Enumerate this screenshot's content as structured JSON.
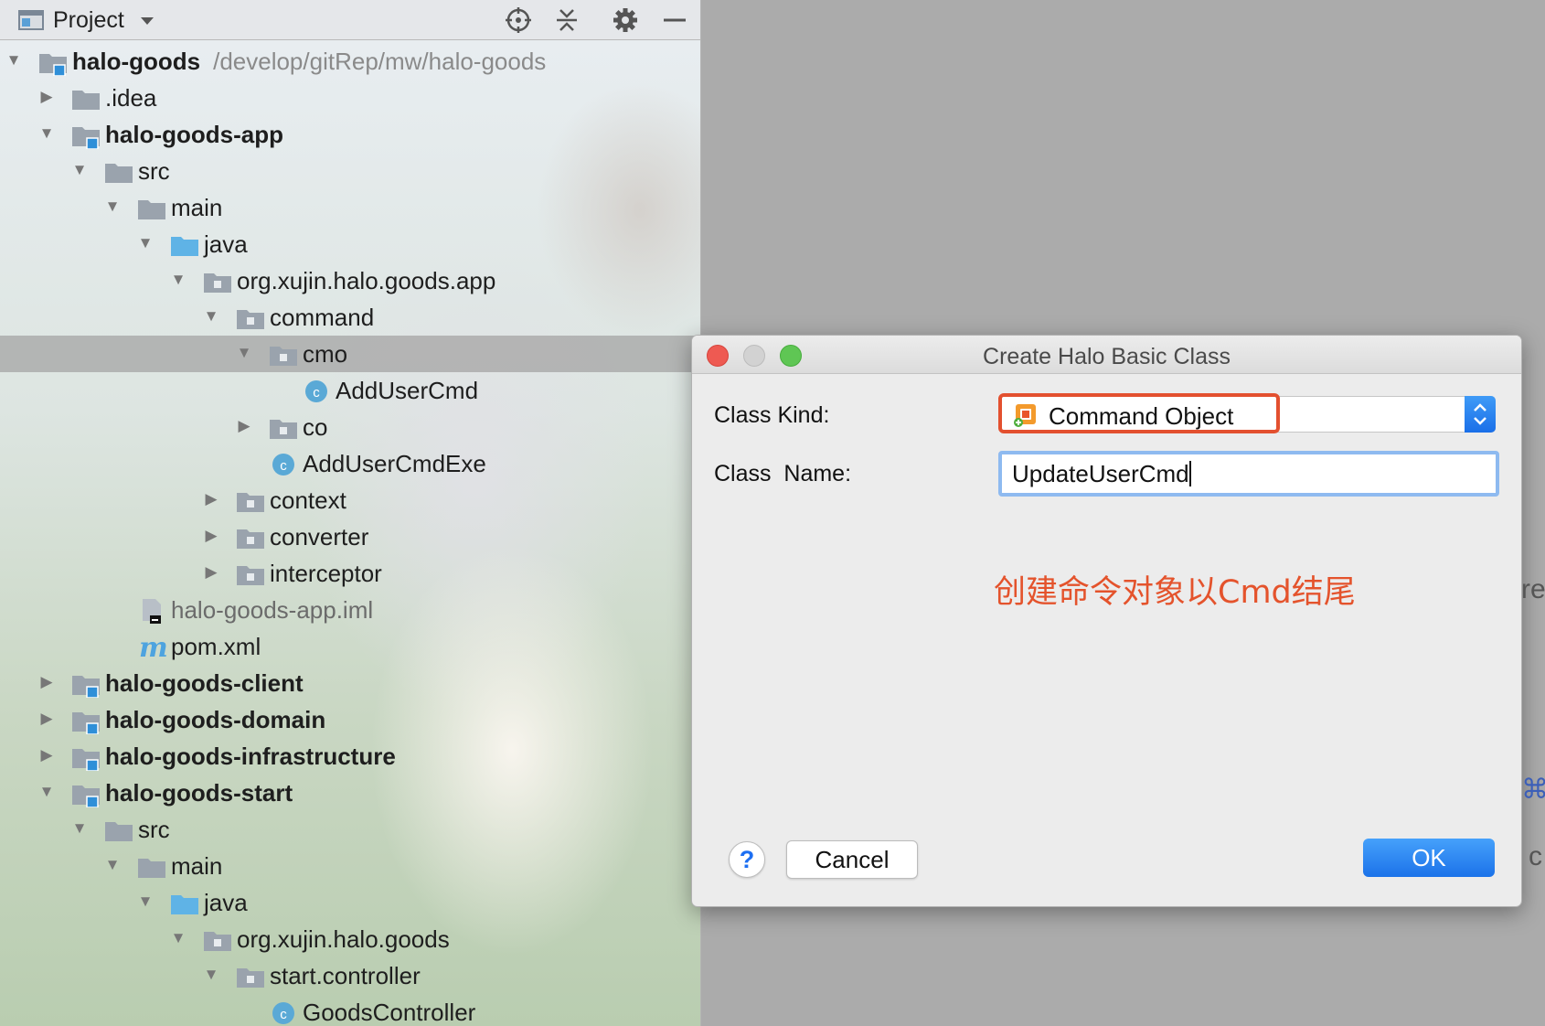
{
  "panel": {
    "title": "Project",
    "icons": [
      "project-window-icon",
      "dropdown-arrow-icon",
      "locate-crosshair-icon",
      "collapse-all-icon",
      "gear-icon",
      "minimize-icon"
    ]
  },
  "tree": [
    {
      "label": "halo-goods",
      "path": "/develop/gitRep/mw/halo-goods",
      "bold": true,
      "depth": 0,
      "expanded": true,
      "icon": "module-folder-icon"
    },
    {
      "label": ".idea",
      "depth": 1,
      "expanded": false,
      "icon": "folder-icon"
    },
    {
      "label": "halo-goods-app",
      "bold": true,
      "depth": 1,
      "expanded": true,
      "icon": "module-folder-icon"
    },
    {
      "label": "src",
      "depth": 2,
      "expanded": true,
      "icon": "folder-icon"
    },
    {
      "label": "main",
      "depth": 3,
      "expanded": true,
      "icon": "folder-icon"
    },
    {
      "label": "java",
      "depth": 4,
      "expanded": true,
      "icon": "source-folder-icon"
    },
    {
      "label": "org.xujin.halo.goods.app",
      "depth": 5,
      "expanded": true,
      "icon": "package-icon"
    },
    {
      "label": "command",
      "depth": 6,
      "expanded": true,
      "icon": "package-icon"
    },
    {
      "label": "cmo",
      "depth": 7,
      "expanded": true,
      "icon": "package-icon",
      "selected": true
    },
    {
      "label": "AddUserCmd",
      "depth": 8,
      "icon": "class-icon"
    },
    {
      "label": "co",
      "depth": 7,
      "expanded": false,
      "icon": "package-icon"
    },
    {
      "label": "AddUserCmdExe",
      "depth": 7,
      "icon": "class-icon"
    },
    {
      "label": "context",
      "depth": 6,
      "expanded": false,
      "icon": "package-icon"
    },
    {
      "label": "converter",
      "depth": 6,
      "expanded": false,
      "icon": "package-icon"
    },
    {
      "label": "interceptor",
      "depth": 6,
      "expanded": false,
      "icon": "package-icon"
    },
    {
      "label": "halo-goods-app.iml",
      "depth": 3,
      "icon": "iml-file-icon",
      "muted": true
    },
    {
      "label": "pom.xml",
      "depth": 3,
      "icon": "maven-icon"
    },
    {
      "label": "halo-goods-client",
      "bold": true,
      "depth": 1,
      "expanded": false,
      "icon": "module-folder-icon"
    },
    {
      "label": "halo-goods-domain",
      "bold": true,
      "depth": 1,
      "expanded": false,
      "icon": "module-folder-icon"
    },
    {
      "label": "halo-goods-infrastructure",
      "bold": true,
      "depth": 1,
      "expanded": false,
      "icon": "module-folder-icon"
    },
    {
      "label": "halo-goods-start",
      "bold": true,
      "depth": 1,
      "expanded": true,
      "icon": "module-folder-icon"
    },
    {
      "label": "src",
      "depth": 2,
      "expanded": true,
      "icon": "folder-icon"
    },
    {
      "label": "main",
      "depth": 3,
      "expanded": true,
      "icon": "folder-icon"
    },
    {
      "label": "java",
      "depth": 4,
      "expanded": true,
      "icon": "source-folder-icon"
    },
    {
      "label": "org.xujin.halo.goods",
      "depth": 5,
      "expanded": true,
      "icon": "package-icon"
    },
    {
      "label": "start.controller",
      "depth": 6,
      "expanded": true,
      "icon": "package-icon"
    },
    {
      "label": "GoodsController",
      "depth": 7,
      "icon": "class-icon"
    }
  ],
  "dialog": {
    "title": "Create Halo Basic Class",
    "class_kind_label": "Class Kind:",
    "class_kind_value": "Command Object",
    "class_name_label": "Class  Name:",
    "class_name_value": "UpdateUserCmd",
    "annotation": "创建命令对象以Cmd结尾",
    "help_label": "?",
    "cancel_label": "Cancel",
    "ok_label": "OK"
  },
  "edge_fragments": [
    "re",
    "⌘",
    "c"
  ],
  "colors": {
    "accent_blue": "#1b72e9",
    "annotation_red": "#e4532c",
    "highlight_border": "#e3502f",
    "folder_blue": "#5fb3e6",
    "class_icon": "#5aa9d6"
  }
}
